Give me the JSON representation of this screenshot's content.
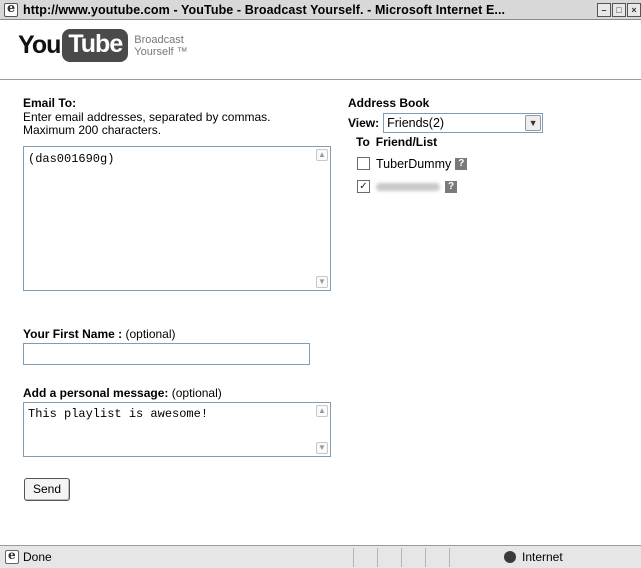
{
  "window": {
    "title": "http://www.youtube.com - YouTube - Broadcast Yourself. - Microsoft Internet E..."
  },
  "logo": {
    "you": "You",
    "tube": "Tube",
    "tagline_line1": "Broadcast",
    "tagline_line2": "Yourself ™"
  },
  "email": {
    "label": "Email To:",
    "help_line1": "Enter email addresses, separated by commas.",
    "help_line2": "Maximum 200 characters.",
    "value": "(das001690g)"
  },
  "first_name": {
    "label": "Your First Name :",
    "optional": " (optional)",
    "value": ""
  },
  "message": {
    "label": "Add a personal message:",
    "optional": " (optional)",
    "value": "This playlist is awesome!"
  },
  "send_label": "Send",
  "address_book": {
    "title": "Address Book",
    "view_label": "View:",
    "view_selected": "Friends(2)",
    "col_to": "To",
    "col_friend": "Friend/List",
    "contacts": [
      {
        "name": "TuberDummy",
        "checked": false,
        "help": "?"
      },
      {
        "name": "",
        "checked": true,
        "help": "?"
      }
    ]
  },
  "status": {
    "text": "Done",
    "zone": "Internet"
  }
}
